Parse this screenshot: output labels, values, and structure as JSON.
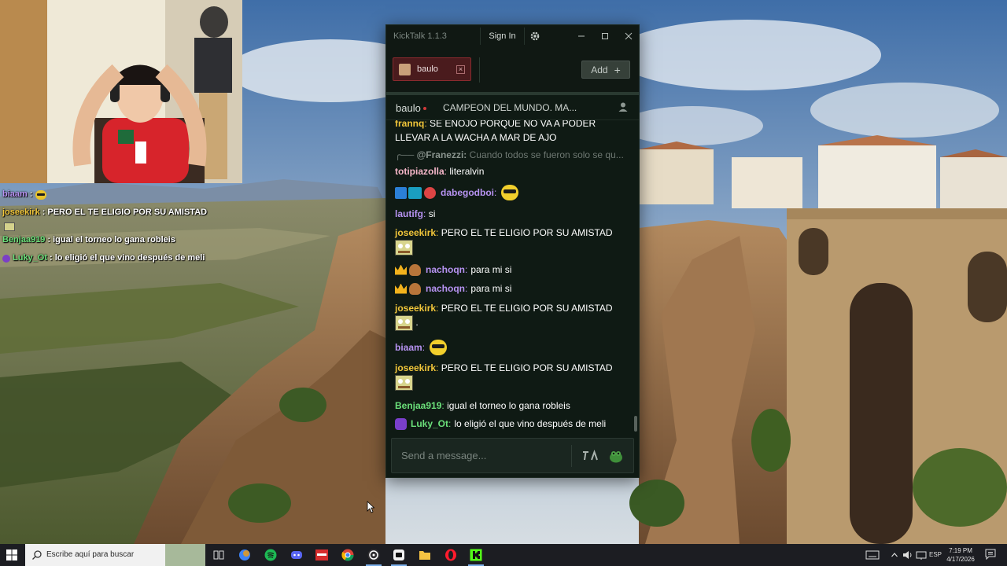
{
  "window": {
    "title": "KickTalk 1.1.3",
    "signin_label": "Sign In"
  },
  "tabs": [
    {
      "label": "baulo",
      "close_symbol": "×"
    }
  ],
  "add_button": {
    "label": "Add",
    "symbol": "+"
  },
  "stream_header": {
    "channel": "baulo",
    "title": "CAMPEON DEL MUNDO. MA..."
  },
  "chat_messages": [
    {
      "user": "frannq",
      "text": "SE ENOJO PORQUE NO VA A PODER LLEVAR A LA WACHA A MAR DE AJO"
    },
    {
      "reply_user": "@Franezzi:",
      "reply_text": "Cuando todos se fueron solo se qu..."
    },
    {
      "user": "totipiazolla",
      "text": "literalvin"
    },
    {
      "user": "dabegodboi",
      "text": ""
    },
    {
      "user": "lautifg",
      "text": "si"
    },
    {
      "user": "joseekirk",
      "text": "PERO EL TE ELIGIO POR SU AMISTAD"
    },
    {
      "user": "nachoqn",
      "text": "para mi si"
    },
    {
      "user": "nachoqn",
      "text": "para mi si"
    },
    {
      "user": "joseekirk",
      "text": "PERO EL TE ELIGIO POR SU AMISTAD",
      "suffix": "."
    },
    {
      "user": "biaam",
      "text": ""
    },
    {
      "user": "joseekirk",
      "text": "PERO EL TE ELIGIO POR SU AMISTAD"
    },
    {
      "user": "Benjaa919",
      "text": "igual el torneo lo gana robleis"
    },
    {
      "user": "Luky_Ot",
      "text": "lo eligió el que vino después de meli"
    }
  ],
  "message_input": {
    "placeholder": "Send a message..."
  },
  "overlay_chat": [
    {
      "user": "biaam",
      "sep": ":",
      "text": ""
    },
    {
      "user": "joseekirk",
      "sep": ":",
      "text": "PERO EL TE ELIGIO POR SU AMISTAD"
    },
    {
      "user": "Benjaa919",
      "sep": ":",
      "text": "igual el torneo lo gana robleis"
    },
    {
      "user": "Luky_Ot",
      "sep": ":",
      "text": "lo eligió el que vino después de meli"
    }
  ],
  "taskbar": {
    "search_placeholder": "Escribe aquí para buscar",
    "language": "ESP",
    "time": "7:19 PM",
    "date": "4/17/2026"
  },
  "colors": {
    "accent_red": "#8a2a2e",
    "window_bg": "#0f1a14",
    "user_yellow": "#f0c53a",
    "user_purple": "#b793f2",
    "user_green": "#6be07a"
  },
  "icons": [
    "settings-gear-icon",
    "minimize-icon",
    "maximize-icon",
    "close-icon",
    "user-icon",
    "translate-icon",
    "emote-icon",
    "windows-start-icon",
    "search-icon"
  ]
}
